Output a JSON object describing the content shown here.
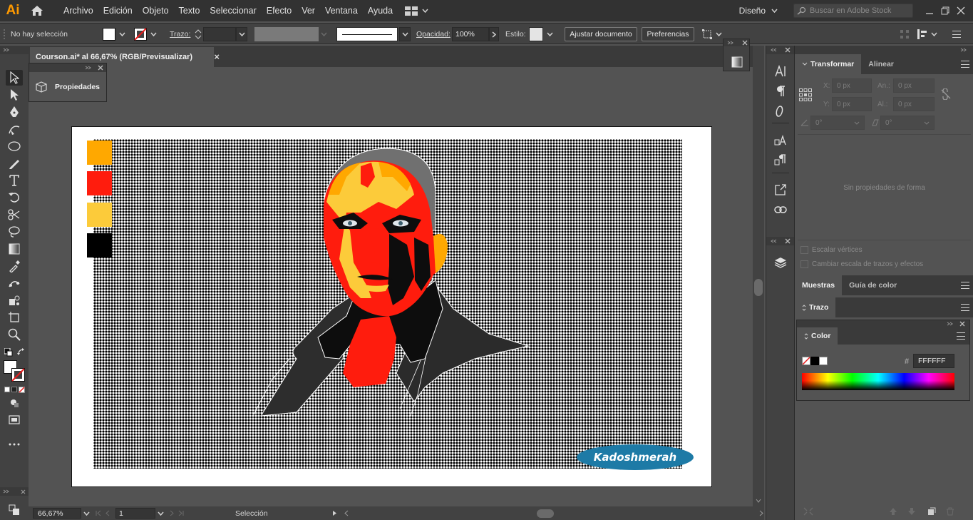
{
  "app": {
    "logo": "Ai"
  },
  "menu": [
    "Archivo",
    "Edición",
    "Objeto",
    "Texto",
    "Seleccionar",
    "Efecto",
    "Ver",
    "Ventana",
    "Ayuda"
  ],
  "workspace": "Diseño",
  "stock_search": {
    "placeholder": "Buscar en Adobe Stock"
  },
  "control": {
    "selection": "No hay selección",
    "stroke_label": "Trazo:",
    "opacity_label": "Opacidad:",
    "opacity_value": "100%",
    "style_label": "Estilo:",
    "fit_button": "Ajustar documento",
    "prefs_button": "Preferencias"
  },
  "document": {
    "tab_title": "Courson.ai* al 66,67% (RGB/Previsualizar)",
    "close": "×"
  },
  "properties_popup": {
    "label": "Propiedades"
  },
  "artwork": {
    "palette": [
      "#ffa800",
      "#ff1c0d",
      "#fccb3a",
      "#000000"
    ],
    "signature": "Kadoshmerah"
  },
  "status": {
    "zoom": "66,67%",
    "page": "1",
    "tool": "Selección"
  },
  "transform": {
    "tabs": [
      "Transformar",
      "Alinear"
    ],
    "x_label": "X:",
    "x_value": "0 px",
    "y_label": "Y:",
    "y_value": "0 px",
    "w_label": "An.:",
    "w_value": "0 px",
    "h_label": "Al.:",
    "h_value": "0 px",
    "angle_value": "0°",
    "shear_value": "0°",
    "empty_message": "Sin propiedades de forma",
    "scale_corners": "Escalar vértices",
    "scale_strokes": "Cambiar escala de trazos y efectos"
  },
  "swatches_tabs": [
    "Muestras",
    "Guía de color"
  ],
  "stroke_panel": {
    "title": "Trazo"
  },
  "color_panel": {
    "title": "Color",
    "hash": "#",
    "hex": "FFFFFF"
  }
}
